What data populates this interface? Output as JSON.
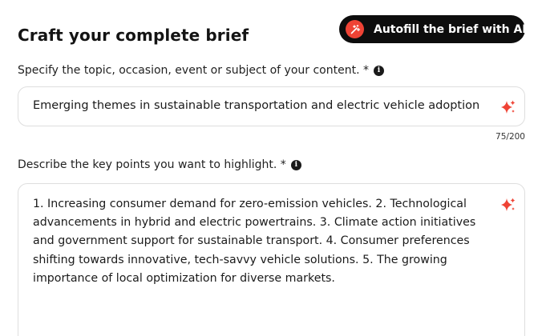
{
  "brief": {
    "title": "Craft your complete brief",
    "autofill_button": "Autofill the brief with AI"
  },
  "topic": {
    "label": "Specify the topic, occasion, event or subject of your content. *",
    "value": "Emerging themes in sustainable transportation and electric vehicle adoption",
    "char_count": "75/200"
  },
  "key_points": {
    "label": "Describe the key points you want to highlight. *",
    "value": "1. Increasing consumer demand for zero-emission vehicles. 2. Technological advancements in hybrid and electric powertrains. 3. Climate action initiatives and government support for sustainable transport. 4. Consumer preferences shifting towards innovative, tech-savvy vehicle solutions. 5. The growing importance of local optimization for diverse markets."
  },
  "colors": {
    "accent": "#ef4335",
    "button_bg": "#0d0d0d"
  },
  "icons": {
    "autofill": "magic-wand-icon",
    "info": "info-icon",
    "ai_suggest": "sparkle-icon"
  }
}
